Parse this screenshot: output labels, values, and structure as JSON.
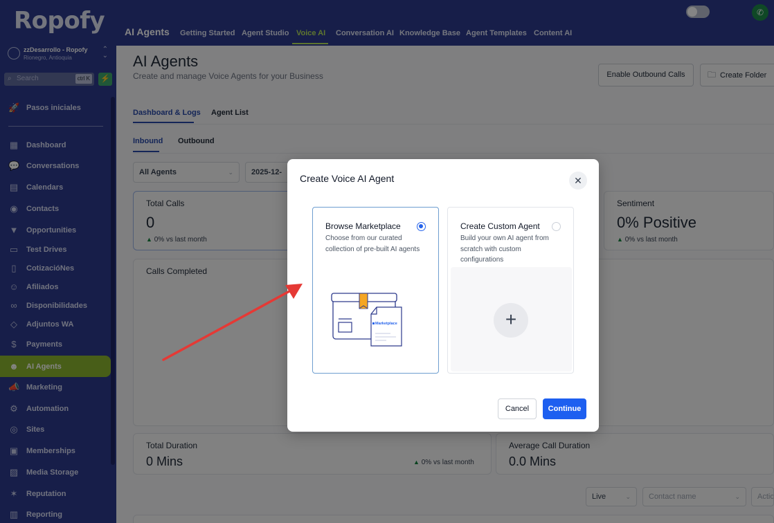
{
  "brand": {
    "logo": "Ropofy"
  },
  "account": {
    "name": "zzDesarrollo - Ropofy",
    "location": "Rionegro, Antioquia"
  },
  "sidebar_search": {
    "placeholder": "Search",
    "shortcut": "ctrl K"
  },
  "sidebar": {
    "top_item": {
      "label": "Pasos iniciales",
      "icon": "rocket-icon"
    },
    "items": [
      {
        "label": "Dashboard",
        "icon": "dashboard-icon"
      },
      {
        "label": "Conversations",
        "icon": "chat-icon"
      },
      {
        "label": "Calendars",
        "icon": "calendar-icon"
      },
      {
        "label": "Contacts",
        "icon": "contact-icon"
      },
      {
        "label": "Opportunities",
        "icon": "funnel-icon"
      },
      {
        "label": "Test Drives",
        "icon": "car-icon"
      },
      {
        "label": "CotizacióNes",
        "icon": "document-icon"
      },
      {
        "label": "Afiliados",
        "icon": "people-icon"
      },
      {
        "label": "Disponibilidades",
        "icon": "link-icon"
      },
      {
        "label": "Adjuntos WA",
        "icon": "box-icon"
      },
      {
        "label": "Payments",
        "icon": "dollar-icon"
      },
      {
        "label": "AI Agents",
        "icon": "robot-icon",
        "active": true
      },
      {
        "label": "Marketing",
        "icon": "megaphone-icon"
      },
      {
        "label": "Automation",
        "icon": "automation-icon"
      },
      {
        "label": "Sites",
        "icon": "globe-icon"
      },
      {
        "label": "Memberships",
        "icon": "membership-icon"
      },
      {
        "label": "Media Storage",
        "icon": "image-icon"
      },
      {
        "label": "Reputation",
        "icon": "star-icon"
      },
      {
        "label": "Reporting",
        "icon": "chart-icon"
      }
    ]
  },
  "topbar": {
    "title": "AI Agents",
    "tabs": [
      "Getting Started",
      "Agent Studio",
      "Voice AI",
      "Conversation AI",
      "Knowledge Base",
      "Agent Templates",
      "Content AI"
    ],
    "active_tab": "Voice AI"
  },
  "page": {
    "title": "AI Agents",
    "subtitle": "Create and manage Voice Agents for your Business",
    "enable_outbound": "Enable Outbound Calls",
    "create_folder": "Create Folder",
    "tabs": [
      "Dashboard & Logs",
      "Agent List"
    ],
    "subtabs": [
      "Inbound",
      "Outbound"
    ],
    "agent_filter": "All Agents",
    "date_filter": "2025-12-"
  },
  "stats": {
    "total_calls": {
      "label": "Total Calls",
      "value": "0",
      "delta": "0%",
      "delta_text": "vs last month"
    },
    "sentiment": {
      "label": "Sentiment",
      "value": "0% Positive",
      "delta": "0%",
      "delta_text": "vs last month"
    },
    "calls_completed": {
      "label": "Calls Completed"
    },
    "total_duration": {
      "label": "Total Duration",
      "value": "0 Mins",
      "delta": "0%",
      "delta_text": "vs last month"
    },
    "avg_duration": {
      "label": "Average Call Duration",
      "value": "0.0 Mins"
    }
  },
  "filters": {
    "live": "Live",
    "contact_placeholder": "Contact name",
    "actions_placeholder": "Actio"
  },
  "modal": {
    "title": "Create Voice AI Agent",
    "options": [
      {
        "title": "Browse Marketplace",
        "description": "Choose from our curated collection of pre-built AI agents",
        "selected": true,
        "illustration_label": "Marketplace"
      },
      {
        "title": "Create Custom Agent",
        "description": "Build your own AI agent from scratch with custom configurations",
        "selected": false
      }
    ],
    "cancel": "Cancel",
    "continue": "Continue"
  },
  "colors": {
    "sidebar": "#2d3a8c",
    "accent_green": "#8ab52f",
    "primary_blue": "#1d5ff0",
    "annotation_arrow": "#e53935"
  }
}
